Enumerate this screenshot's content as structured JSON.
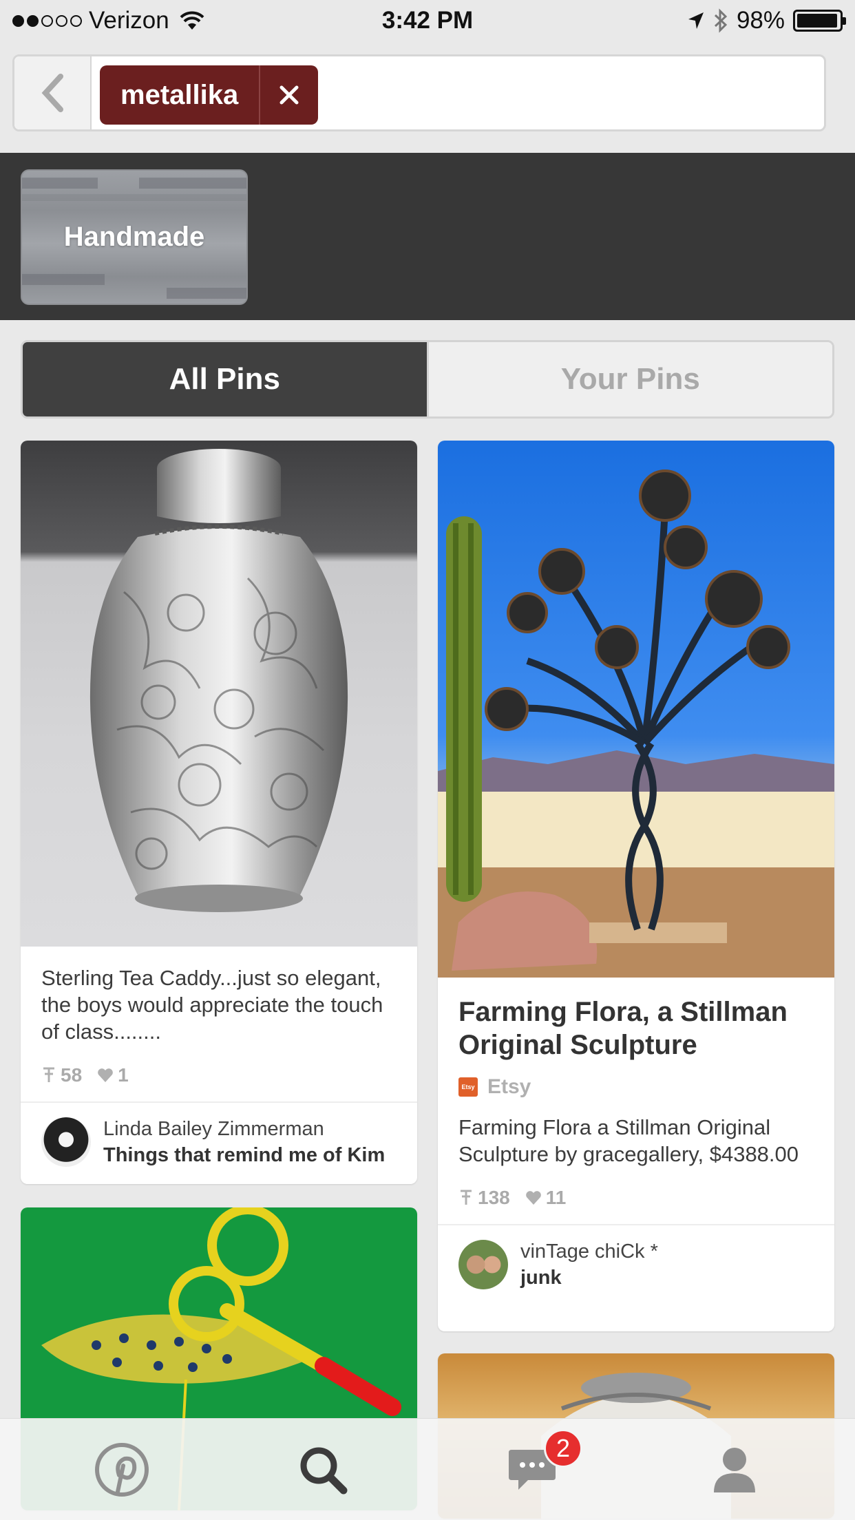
{
  "status_bar": {
    "carrier": "Verizon",
    "time": "3:42 PM",
    "battery": "98%",
    "signal_bars": 2,
    "icons": [
      "wifi-icon",
      "location-arrow-icon",
      "bluetooth-icon",
      "battery-icon"
    ]
  },
  "search": {
    "back_icon": "chevron-left-icon",
    "token": "metallika",
    "remove_icon": "close-icon"
  },
  "guide": {
    "label": "Handmade"
  },
  "tabs": {
    "all_pins": "All Pins",
    "your_pins": "Your Pins",
    "active": "All Pins"
  },
  "pins": [
    {
      "description": "Sterling Tea Caddy...just so elegant, the boys would appreciate the touch of class........",
      "repins": "58",
      "likes": "1",
      "pinner": "Linda Bailey Zimmerman",
      "board": "Things that remind me of Kim"
    },
    {
      "title": "Farming Flora, a Stillman Original Sculpture",
      "source": "Etsy",
      "source_icon_text": "Etsy",
      "description": "Farming Flora a Stillman Original Sculpture by gracegallery, $4388.00",
      "repins": "138",
      "likes": "11",
      "pinner": "vinTage chiCk *",
      "board": "junk"
    }
  ],
  "tab_bar": {
    "items": [
      "pinterest-logo-icon",
      "search-icon",
      "messages-icon",
      "profile-icon"
    ],
    "active": "search-icon",
    "notification_count": "2"
  },
  "colors": {
    "token_bg": "#6b1f1f",
    "guide_strip_bg": "#373737",
    "active_segment_bg": "#404040",
    "badge_red": "#e62e2e",
    "source_orange": "#e0602a"
  }
}
